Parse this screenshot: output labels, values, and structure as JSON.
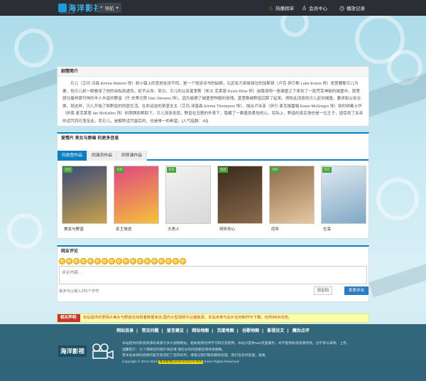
{
  "header": {
    "logo_text": "海洋影视",
    "logo_sub": "www.hyysw.com",
    "nav_button": "导航",
    "links": [
      {
        "label": "热播榜单",
        "icon": "flame-icon"
      },
      {
        "label": "会员中心",
        "icon": "user-icon"
      },
      {
        "label": "播放记录",
        "icon": "clock-icon"
      }
    ]
  },
  "synopsis": {
    "title": "剧情简介",
    "body": "贝儿（艾玛·沃森 Emma Watson 饰）和小镇上的其他女孩不同，是一个饱读诗书的姑娘，孔武有力英俊强壮的加斯顿（卢克·伊万斯 Luke Evans 饰）发誓要娶贝儿为妻，但贝儿却一眼看穿了他的自私和虚伪，拒不从命。某日，贝儿的父亲莫里斯（凯文·克莱恩 Kevin Kline 饰）迷路误闯一座城堡之下来到了一座荒芜神秘的城堡中，那里居住着样貌可怖的半人半兽的野兽（丹·史蒂文斯 Dan Stevens 饰）。因为偷摘了城堡里种植的玫瑰，莫里斯被野兽囚禁了起来。得知此消息的贝儿赶到城堡，要求和父亲交换，就这样，贝儿开始了和野兽的同居生活。在命运说的茶壶太太（艾玛·汤普森 Emma Thompson 饰）、烛台卢米亚（伊万·麦克格雷格 Ewan McGregor 饰）和时钟葛士华（伊恩·麦克莱恩 Ian McKellen 饰）的照顾和帮助下，贝儿渐渐发现，野兽在丑陋的外表下，隐藏了一颗善良柔软的心。实际上，野兽的真实身份是一位王子，因受到了女巫的诅咒而沦落至此。而贝儿，是解除诅咒最后的，也是唯一的希望。[人气指数：43]"
  },
  "more": {
    "title": "爱情片 美女与野兽 的更多信息",
    "tabs": [
      "同类型作品",
      "同演员作品",
      "同导演作品"
    ],
    "active_tab": 0,
    "cards": [
      {
        "title": "美女与野兽",
        "score": "0.0",
        "colors": [
          "#3a4a7a",
          "#c9a24a"
        ]
      },
      {
        "title": "女王旅途",
        "score": "0.0",
        "colors": [
          "#e04680",
          "#f5c23a"
        ]
      },
      {
        "title": "大男人",
        "score": "0.0",
        "colors": [
          "#f2f2f2",
          "#d8d8d8"
        ]
      },
      {
        "title": "倾听你心",
        "score": "0.0",
        "colors": [
          "#3a2a1e",
          "#8a6a4a"
        ]
      },
      {
        "title": "闰年",
        "score": "0.0",
        "colors": [
          "#8a6a4a",
          "#e8c8a0"
        ]
      },
      {
        "title": "左耳",
        "score": "0.0",
        "colors": [
          "#dfeaf2",
          "#7fa8c4"
        ]
      }
    ]
  },
  "comments": {
    "title": "网友评论",
    "placeholder": "评论内容...",
    "char_limit": "最多可以输入255个字符",
    "captcha_label": "验证码",
    "submit_label": "发表评论",
    "emoji_count": 18
  },
  "notice": {
    "label": "相关声明:",
    "text": "本站提供的爱情片美女与野兽在线观看数据来自,国内大型视频平台播放源。本站未参与此片任何制作与下载，仅供WEB浏览。"
  },
  "footer": {
    "links": [
      "网站目录",
      "常见问题",
      "留言建议",
      "网站地图",
      "百度地图",
      "谷歌地图",
      "影视论文",
      "魔后点评"
    ],
    "logo_text": "海洋影视",
    "lines": [
      "本站提供的影视资源均来源于多大视频网站，相关视频仅供学习和交流使用，本站只提供web页面服务，并不提供影视资源存储，也不参与录制、上传。",
      "温馨提示：为了保障您的观片体验请 请在长时间观看后请休息眼睛。",
      "若本站收录的视频内容无意侵犯了您的权利，请速与我们联系删除处理，我们会及时处理，谢谢。",
      "Copyright © 2012-2015"
    ],
    "copyright_site": "海洋影视(www.SouCinz.Net)",
    "rights": "Some Rights Reserved"
  },
  "colors": {
    "accent": "#0c7fc4",
    "topbar": "#2b2f35",
    "score_badge": "#4aa33a",
    "notice_bg": "#ffffa8",
    "notice_text": "#c0392b"
  }
}
